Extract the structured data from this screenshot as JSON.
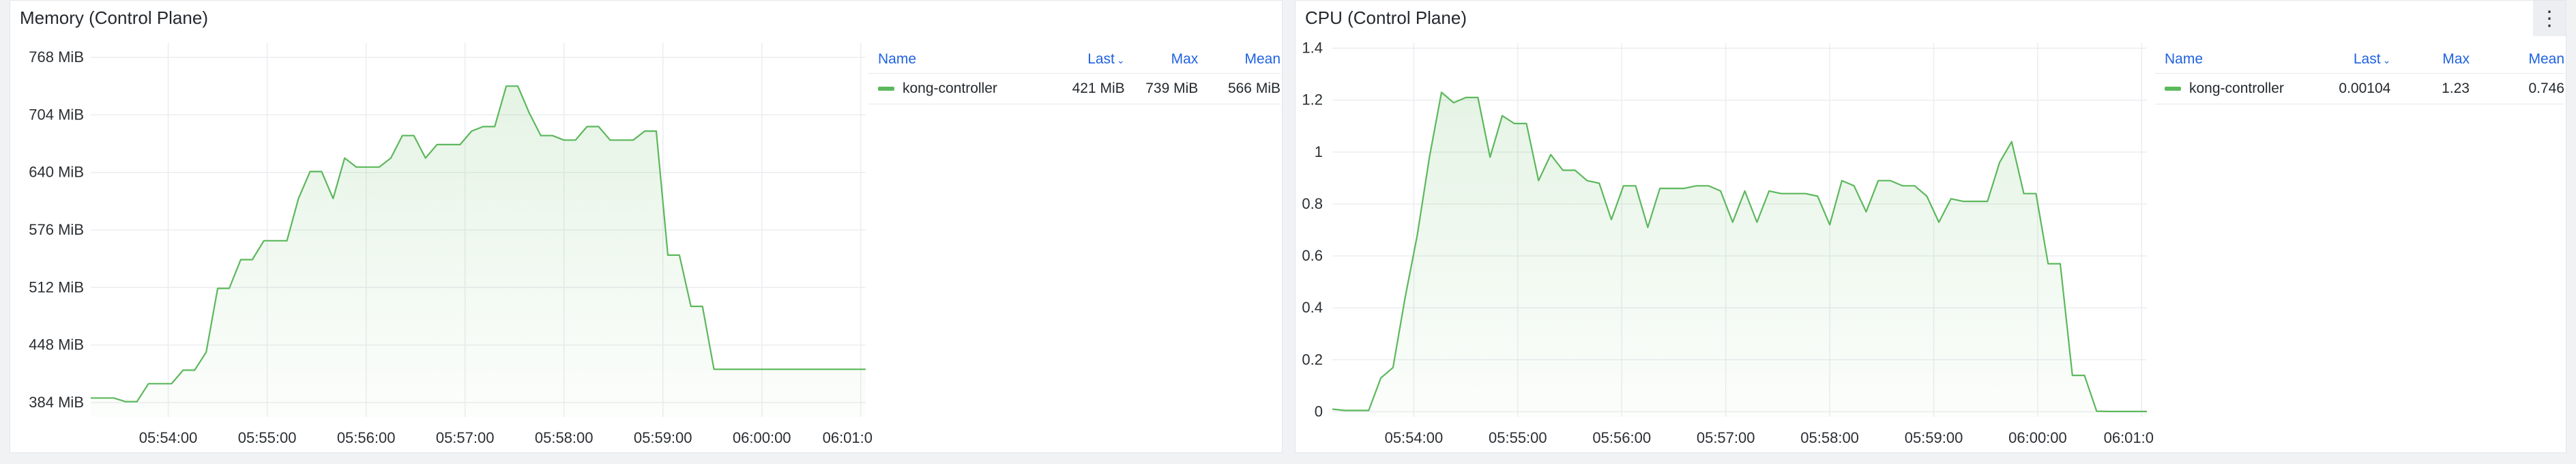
{
  "colors": {
    "series": "#5cb85c",
    "grid": "#ebedf0",
    "axis_text": "#2b2f33"
  },
  "panels": [
    {
      "title": "Memory (Control Plane)",
      "legend": {
        "headers": {
          "name": "Name",
          "last": "Last",
          "max": "Max",
          "mean": "Mean"
        },
        "rows": [
          {
            "name": "kong-controller",
            "last": "421 MiB",
            "max": "739 MiB",
            "mean": "566 MiB"
          }
        ]
      }
    },
    {
      "title": "CPU (Control Plane)",
      "menu_icon": "⋮",
      "legend": {
        "headers": {
          "name": "Name",
          "last": "Last",
          "max": "Max",
          "mean": "Mean"
        },
        "rows": [
          {
            "name": "kong-controller",
            "last": "0.00104",
            "max": "1.23",
            "mean": "0.746"
          }
        ]
      }
    }
  ],
  "chart_data": [
    {
      "type": "area",
      "title": "Memory (Control Plane)",
      "unit": "MiB",
      "y_ticks": [
        384,
        448,
        512,
        576,
        640,
        704,
        768
      ],
      "y_tick_labels": [
        "384 MiB",
        "448 MiB",
        "512 MiB",
        "576 MiB",
        "640 MiB",
        "704 MiB",
        "768 MiB"
      ],
      "ylim": [
        368,
        784
      ],
      "x_range": [
        "05:53:13",
        "06:01:03"
      ],
      "x_ticks": [
        "05:54:00",
        "05:55:00",
        "05:56:00",
        "05:57:00",
        "05:58:00",
        "05:59:00",
        "06:00:00",
        "06:01:00"
      ],
      "x_tick_labels": [
        "05:54:00",
        "05:55:00",
        "05:56:00",
        "05:57:00",
        "05:58:00",
        "05:59:00",
        "06:00:00",
        "06:01:0"
      ],
      "grid": true,
      "series": [
        {
          "name": "kong-controller",
          "x": [
            "05:53:13",
            "05:53:27",
            "05:53:34",
            "05:53:41",
            "05:53:48",
            "05:53:55",
            "05:54:02",
            "05:54:09",
            "05:54:16",
            "05:54:23",
            "05:54:30",
            "05:54:37",
            "05:54:44",
            "05:54:51",
            "05:54:58",
            "05:55:05",
            "05:55:12",
            "05:55:19",
            "05:55:26",
            "05:55:33",
            "05:55:40",
            "05:55:47",
            "05:55:54",
            "05:56:01",
            "05:56:08",
            "05:56:15",
            "05:56:22",
            "05:56:29",
            "05:56:36",
            "05:56:43",
            "05:56:50",
            "05:56:57",
            "05:57:04",
            "05:57:11",
            "05:57:18",
            "05:57:25",
            "05:57:32",
            "05:57:39",
            "05:57:46",
            "05:57:53",
            "05:58:00",
            "05:58:07",
            "05:58:14",
            "05:58:21",
            "05:58:28",
            "05:58:35",
            "05:58:42",
            "05:58:49",
            "05:58:56",
            "05:59:03",
            "05:59:10",
            "05:59:17",
            "05:59:24",
            "05:59:31",
            "05:59:38",
            "05:59:45",
            "05:59:52",
            "05:59:59",
            "06:00:06",
            "06:00:13",
            "06:00:20",
            "06:01:03"
          ],
          "y": [
            389,
            389,
            385,
            385,
            405,
            405,
            405,
            420,
            420,
            440,
            511,
            511,
            543,
            543,
            564,
            564,
            564,
            611,
            641,
            641,
            611,
            656,
            646,
            646,
            646,
            656,
            681,
            681,
            656,
            671,
            671,
            671,
            686,
            691,
            691,
            736,
            736,
            706,
            681,
            681,
            676,
            676,
            691,
            691,
            676,
            676,
            676,
            686,
            686,
            548,
            548,
            491,
            491,
            421,
            421,
            421,
            421,
            421,
            421,
            421,
            421,
            421
          ]
        }
      ]
    },
    {
      "type": "area",
      "title": "CPU (Control Plane)",
      "y_ticks": [
        0,
        0.2,
        0.4,
        0.6,
        0.8,
        1,
        1.2,
        1.4
      ],
      "y_tick_labels": [
        "0",
        "0.2",
        "0.4",
        "0.6",
        "0.8",
        "1",
        "1.2",
        "1.4"
      ],
      "ylim": [
        -0.02,
        1.42
      ],
      "x_range": [
        "05:53:13",
        "06:01:03"
      ],
      "x_ticks": [
        "05:54:00",
        "05:55:00",
        "05:56:00",
        "05:57:00",
        "05:58:00",
        "05:59:00",
        "06:00:00",
        "06:01:00"
      ],
      "x_tick_labels": [
        "05:54:00",
        "05:55:00",
        "05:56:00",
        "05:57:00",
        "05:58:00",
        "05:59:00",
        "06:00:00",
        "06:01:0"
      ],
      "grid": true,
      "series": [
        {
          "name": "kong-controller",
          "x": [
            "05:53:13",
            "05:53:20",
            "05:53:27",
            "05:53:34",
            "05:53:41",
            "05:53:48",
            "05:53:55",
            "05:54:02",
            "05:54:09",
            "05:54:16",
            "05:54:23",
            "05:54:30",
            "05:54:37",
            "05:54:44",
            "05:54:51",
            "05:54:58",
            "05:55:05",
            "05:55:12",
            "05:55:19",
            "05:55:26",
            "05:55:33",
            "05:55:40",
            "05:55:47",
            "05:55:54",
            "05:56:01",
            "05:56:08",
            "05:56:15",
            "05:56:22",
            "05:56:29",
            "05:56:36",
            "05:56:43",
            "05:56:50",
            "05:56:57",
            "05:57:04",
            "05:57:11",
            "05:57:18",
            "05:57:25",
            "05:57:32",
            "05:57:39",
            "05:57:46",
            "05:57:53",
            "05:58:00",
            "05:58:07",
            "05:58:14",
            "05:58:21",
            "05:58:28",
            "05:58:35",
            "05:58:42",
            "05:58:49",
            "05:58:56",
            "05:59:03",
            "05:59:10",
            "05:59:17",
            "05:59:24",
            "05:59:31",
            "05:59:38",
            "05:59:45",
            "05:59:52",
            "05:59:59",
            "06:00:06",
            "06:00:13",
            "06:00:20",
            "06:00:27",
            "06:00:34",
            "06:00:41",
            "06:00:48",
            "06:00:55",
            "06:01:03"
          ],
          "y": [
            0.01,
            0.005,
            0.005,
            0.005,
            0.13,
            0.17,
            0.44,
            0.68,
            0.98,
            1.23,
            1.19,
            1.21,
            1.21,
            0.98,
            1.14,
            1.11,
            1.11,
            0.89,
            0.99,
            0.93,
            0.93,
            0.89,
            0.88,
            0.74,
            0.87,
            0.87,
            0.71,
            0.86,
            0.86,
            0.86,
            0.87,
            0.87,
            0.85,
            0.73,
            0.85,
            0.73,
            0.85,
            0.84,
            0.84,
            0.84,
            0.83,
            0.72,
            0.89,
            0.87,
            0.77,
            0.89,
            0.89,
            0.87,
            0.87,
            0.83,
            0.73,
            0.82,
            0.81,
            0.81,
            0.81,
            0.96,
            1.04,
            0.84,
            0.84,
            0.57,
            0.57,
            0.14,
            0.14,
            0.002,
            0.001,
            0.001,
            0.001,
            0.00104
          ]
        }
      ]
    }
  ]
}
